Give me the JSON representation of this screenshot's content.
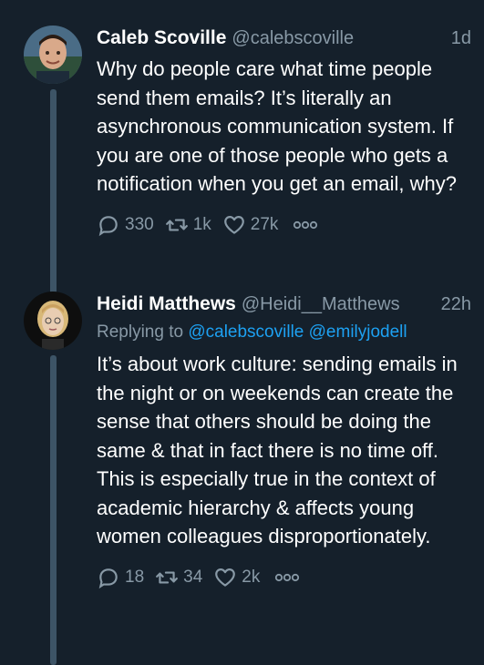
{
  "tweets": [
    {
      "name": "Caleb Scoville",
      "handle": "@calebscoville",
      "time": "1d",
      "text": "Why do people care what time people send them emails? It’s literally an asynchronous communication system. If you are one of those people who gets a notification when you get an email, why?",
      "replies": "330",
      "retweets": "1k",
      "likes": "27k"
    },
    {
      "name": "Heidi Matthews",
      "handle": "@Heidi__Matthews",
      "time": "22h",
      "replying_label": "Replying to",
      "replying_to": [
        "@calebscoville",
        "@emilyjodell"
      ],
      "text": "It’s about work culture: sending emails in the night or on weekends can create the sense that others should be doing the same & that in fact there is no time off. This is especially true in the context of academic hierarchy & affects young women colleagues disproportionately.",
      "replies": "18",
      "retweets": "34",
      "likes": "2k"
    }
  ],
  "icons": {
    "reply": "comment-icon",
    "retweet": "retweet-icon",
    "like": "heart-icon",
    "more": "more-dots-icon"
  },
  "colors": {
    "background": "#15202b",
    "secondary_text": "#8899a6",
    "link": "#1da1f2",
    "thread_line": "#3d5466"
  }
}
